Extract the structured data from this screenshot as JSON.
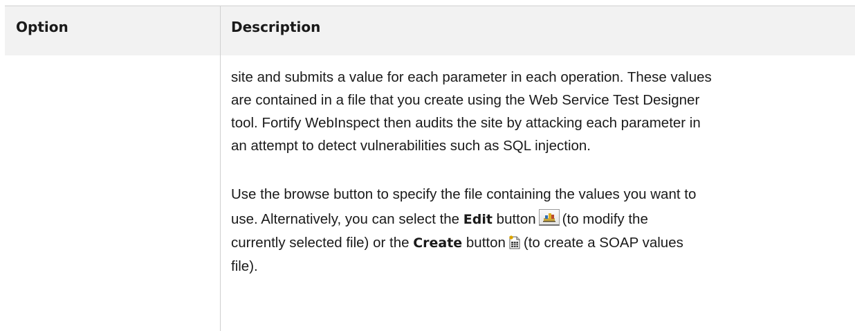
{
  "table": {
    "headers": {
      "option": "Option",
      "description": "Description"
    },
    "paragraph1": {
      "lines": [
        "site and submits a value for each parameter in each operation. These values",
        "are contained in a file that you create using the Web Service Test Designer",
        "tool. Fortify WebInspect then audits the site by attacking each parameter in",
        "an attempt to detect vulnerabilities such as SQL injection."
      ]
    },
    "paragraph2": {
      "line1": "Use the browse button to specify the file containing the values you want to",
      "line2_pre": "use. Alternatively, you can select the ",
      "edit_word": "Edit",
      "line2_mid": " button",
      "line2_post": "(to modify the",
      "line3_pre": "currently selected file) or the ",
      "create_word": "Create",
      "line3_mid": " button",
      "line3_post": "(to create a SOAP values",
      "line4": "file)."
    }
  },
  "icons": {
    "edit": "edit-values-file-icon",
    "create": "create-values-file-icon"
  }
}
